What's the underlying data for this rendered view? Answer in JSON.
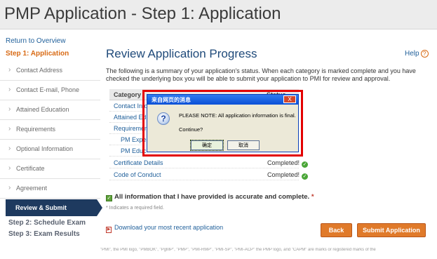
{
  "header": {
    "title": "PMP Application - Step 1: Application"
  },
  "sidebar": {
    "return_link": "Return to Overview",
    "current_step": "Step 1: Application",
    "items": [
      {
        "label": "Contact Address"
      },
      {
        "label": "Contact E-mail, Phone"
      },
      {
        "label": "Attained Education"
      },
      {
        "label": "Requirements"
      },
      {
        "label": "Optional Information"
      },
      {
        "label": "Certificate"
      },
      {
        "label": "Agreement"
      }
    ],
    "active_item": "Review & Submit",
    "step2": "Step 2: Schedule Exam",
    "step3": "Step 3: Exam Results"
  },
  "main": {
    "title": "Review Application Progress",
    "help": "Help",
    "summary": "The following is a summary of your application's status. When each category is marked complete and you have checked the underlying box you will be able to submit your application to PMI for review and approval.",
    "table": {
      "col_category": "Category",
      "col_status": "Status",
      "rows": [
        {
          "category": "Contact Info",
          "status": ""
        },
        {
          "category": "Attained Edu",
          "status": ""
        },
        {
          "category": "Requirements",
          "status": ""
        },
        {
          "category": "PM Exper",
          "status": ""
        },
        {
          "category": "PM Educ",
          "status": ""
        },
        {
          "category": "Certificate Details",
          "status": "Completed!"
        },
        {
          "category": "Code of Conduct",
          "status": "Completed!"
        }
      ]
    },
    "agreement_text": "All information that I have provided is accurate and complete.",
    "required_star": "*",
    "required_note": "* Indicates a required field.",
    "download_link": "Download your most recent application",
    "back_label": "Back",
    "submit_label": "Submit Application",
    "footer_note": "\"PMI\", the PMI logo, \"PMBOK\", \"PgMP\", \"PMP\", \"PMI-RMP\", \"PMI-SP\", \"PMI-ACP\" the PMP logo, and \"CAPM\" are marks or registered marks of the"
  },
  "dialog": {
    "title": "来自网页的消息",
    "close": "X",
    "message": "PLEASE NOTE: All application information is final.",
    "question": "Continue?",
    "ok_label": "确定",
    "cancel_label": "取消"
  },
  "colors": {
    "accent": "#e07a2a",
    "nav_active": "#1e3a5f",
    "highlight": "#e30000"
  }
}
